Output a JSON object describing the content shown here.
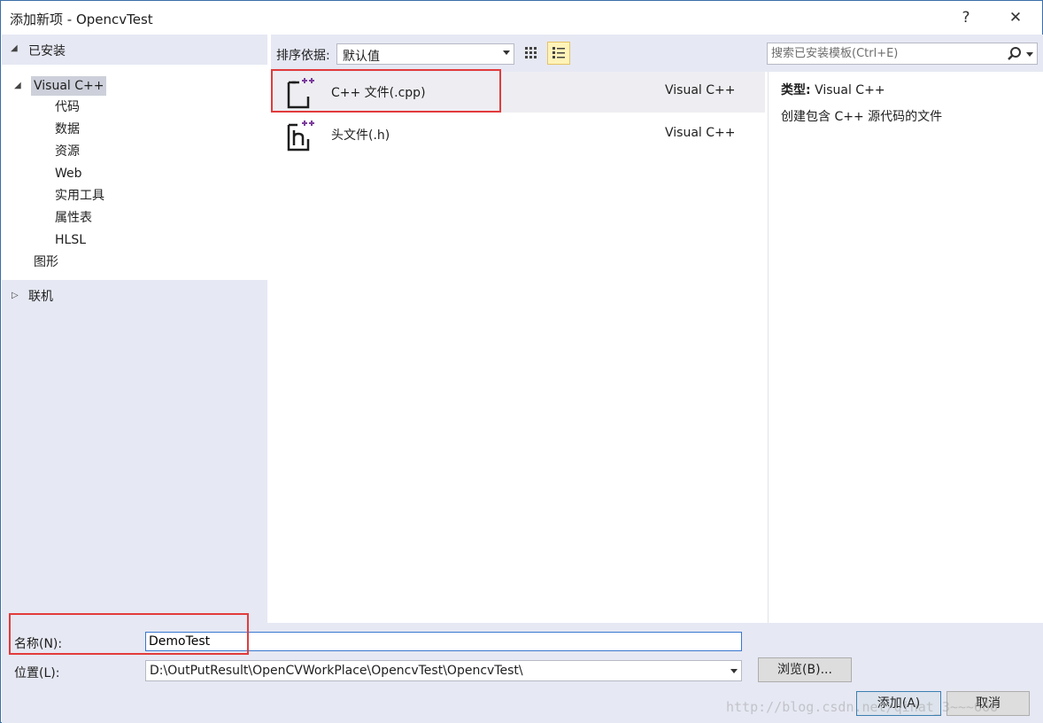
{
  "window": {
    "title": "添加新项 - OpencvTest",
    "help_label": "?",
    "close_label": "✕"
  },
  "sidebar": {
    "installed_label": "已安装",
    "root_label": "Visual C++",
    "children": [
      "代码",
      "数据",
      "资源",
      "Web",
      "实用工具",
      "属性表",
      "HLSL"
    ],
    "sibling_label": "图形",
    "online_label": "联机"
  },
  "sortbar": {
    "label": "排序依据:",
    "selected": "默认值"
  },
  "templates": [
    {
      "name": "C++ 文件(.cpp)",
      "lang": "Visual C++",
      "icon": "cpp-file-icon",
      "selected": true
    },
    {
      "name": "头文件(.h)",
      "lang": "Visual C++",
      "icon": "header-file-icon",
      "selected": false
    }
  ],
  "search": {
    "placeholder": "搜索已安装模板(Ctrl+E)",
    "icon": "search-icon"
  },
  "details": {
    "type_label": "类型:",
    "type_value": "Visual C++",
    "description": "创建包含 C++ 源代码的文件"
  },
  "form": {
    "name_label": "名称(N):",
    "name_value": "DemoTest",
    "location_label": "位置(L):",
    "location_value": "D:\\OutPutResult\\OpenCVWorkPlace\\OpencvTest\\OpencvTest\\",
    "browse_label": "浏览(B)...",
    "add_label": "添加(A)",
    "cancel_label": "取消"
  },
  "watermark": "http://blog.csdn.net/qinat_3~~~666",
  "colors": {
    "panel_bg": "#e6e8f3",
    "highlight_red": "#e23b3b",
    "accent_purple": "#7b3d9e"
  }
}
